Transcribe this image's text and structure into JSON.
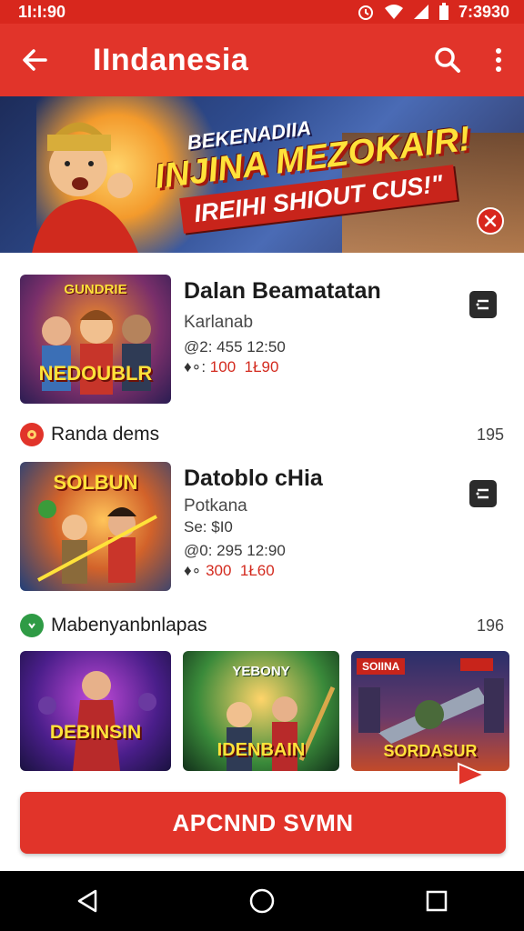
{
  "status_bar": {
    "time_left": "1I:I:90",
    "time_right": "7:3930",
    "icons": [
      "alarm-icon",
      "wifi-icon",
      "signal-icon",
      "battery-icon"
    ]
  },
  "app_bar": {
    "title": "IIndanesia",
    "back_icon": "arrow-left-icon",
    "search_icon": "search-icon",
    "more_icon": "more-vertical-icon"
  },
  "banner": {
    "kicker": "BEKENADIIA",
    "headline": "INJINA MEZOKAIR!",
    "subline": "IREIHI SHIOUT CUS!\"",
    "close_icon": "close-icon"
  },
  "items": [
    {
      "name": "Dalan Beamatatan",
      "developer": "Karlanab",
      "meta": "@2: 455  12:50",
      "price_symbol": "♦∘:",
      "price_a": "100",
      "price_b": "1Ł90",
      "thumb_title": "NEDOUBLR",
      "thumb_caption": "GUNDRIE"
    },
    {
      "name": "Datoblo cHia",
      "developer": "Potkana",
      "sub_price": "Se: $I0",
      "meta": "@0: 295  12:90",
      "price_symbol": "♦∘",
      "price_a": "300",
      "price_b": "1Ł60",
      "thumb_title": "SOLBUN"
    }
  ],
  "sections": [
    {
      "label": "Randa dems",
      "count": "195",
      "icon": "game-badge-icon",
      "icon_color": "#e1342a"
    },
    {
      "label": "Mabenyanbnlapas",
      "count": "196",
      "icon": "play-badge-icon",
      "icon_color": "#2f9b45"
    }
  ],
  "grid": [
    {
      "caption": "DEBINSIN"
    },
    {
      "caption": "IDENBAIN",
      "top": "YEBONY"
    },
    {
      "caption": "SORDASUR",
      "tag_left": "SOIINA"
    }
  ],
  "cta": {
    "label": "APCNND SVMN"
  },
  "nav": {
    "back_icon": "nav-back-icon",
    "home_icon": "nav-home-icon",
    "recents_icon": "nav-recents-icon"
  },
  "colors": {
    "primary": "#e1342a",
    "status": "#d8271d",
    "accent_yellow": "#ffe23a"
  }
}
